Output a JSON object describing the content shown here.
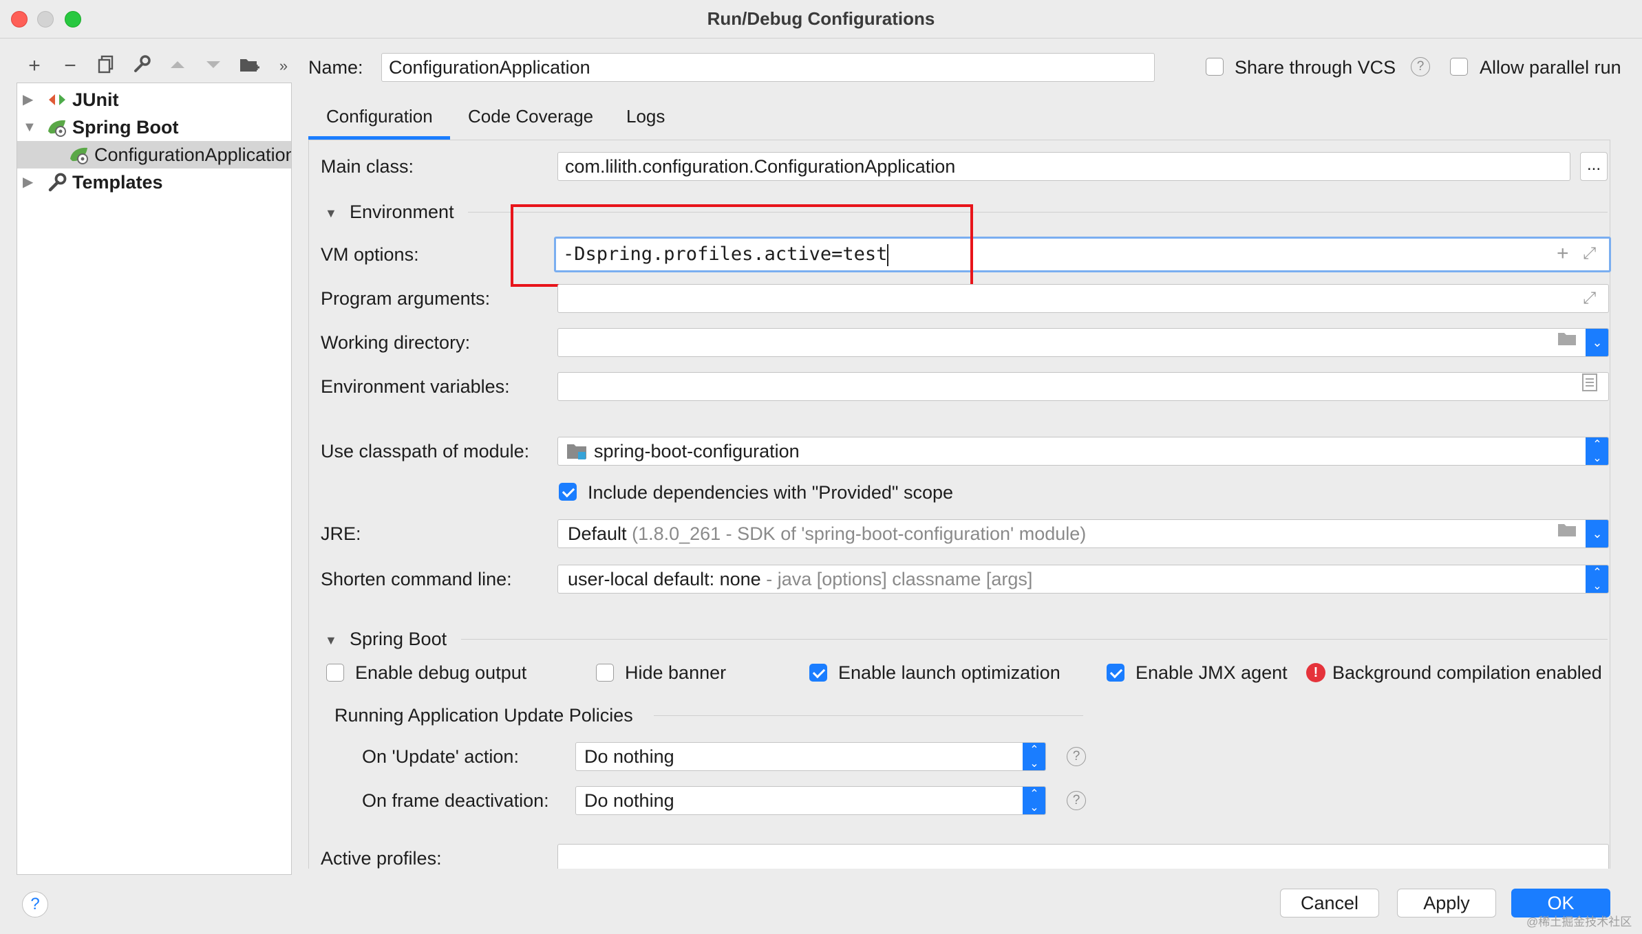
{
  "window": {
    "title": "Run/Debug Configurations"
  },
  "tree": {
    "items": [
      {
        "label": "JUnit",
        "expanded": false,
        "icon": "junit-icon"
      },
      {
        "label": "Spring Boot",
        "expanded": true,
        "icon": "spring-boot-icon"
      },
      {
        "label": "ConfigurationApplication",
        "selected": true,
        "icon": "spring-boot-run-icon"
      },
      {
        "label": "Templates",
        "expanded": false,
        "icon": "wrench-icon"
      }
    ]
  },
  "header": {
    "name_label": "Name:",
    "name_value": "ConfigurationApplication",
    "share_vcs_label": "Share through VCS",
    "share_vcs_checked": false,
    "allow_parallel_label": "Allow parallel run",
    "allow_parallel_checked": false
  },
  "tabs": [
    {
      "label": "Configuration",
      "active": true
    },
    {
      "label": "Code Coverage",
      "active": false
    },
    {
      "label": "Logs",
      "active": false
    }
  ],
  "config": {
    "main_class_label": "Main class:",
    "main_class_value": "com.lilith.configuration.ConfigurationApplication",
    "browse_label": "...",
    "environment_label": "Environment",
    "vm_options_label": "VM options:",
    "vm_options_value": "-Dspring.profiles.active=test",
    "program_args_label": "Program arguments:",
    "program_args_value": "",
    "working_dir_label": "Working directory:",
    "working_dir_value": "",
    "env_vars_label": "Environment variables:",
    "env_vars_value": "",
    "classpath_label": "Use classpath of module:",
    "classpath_value": "spring-boot-configuration",
    "include_deps_label": "Include dependencies with \"Provided\" scope",
    "include_deps_checked": true,
    "jre_label": "JRE:",
    "jre_value": "Default",
    "jre_detail": "(1.8.0_261 - SDK of 'spring-boot-configuration' module)",
    "shorten_label": "Shorten command line:",
    "shorten_value": "user-local default: none",
    "shorten_detail": "- java [options] classname [args]"
  },
  "spring_boot": {
    "section_label": "Spring Boot",
    "enable_debug_label": "Enable debug output",
    "enable_debug_checked": false,
    "hide_banner_label": "Hide banner",
    "hide_banner_checked": false,
    "launch_opt_label": "Enable launch optimization",
    "launch_opt_checked": true,
    "jmx_label": "Enable JMX agent",
    "jmx_checked": true,
    "bg_compilation_label": "Background compilation enabled",
    "policies_label": "Running Application Update Policies",
    "on_update_label": "On 'Update' action:",
    "on_update_value": "Do nothing",
    "on_frame_label": "On frame deactivation:",
    "on_frame_value": "Do nothing",
    "active_profiles_label": "Active profiles:",
    "active_profiles_value": ""
  },
  "footer": {
    "help_label": "?",
    "cancel_label": "Cancel",
    "apply_label": "Apply",
    "ok_label": "OK"
  },
  "watermark": "@稀土掘金技术社区",
  "colors": {
    "accent": "#1a7dff",
    "highlight_box": "#e8141a",
    "focus_ring": "#7aaef0"
  }
}
